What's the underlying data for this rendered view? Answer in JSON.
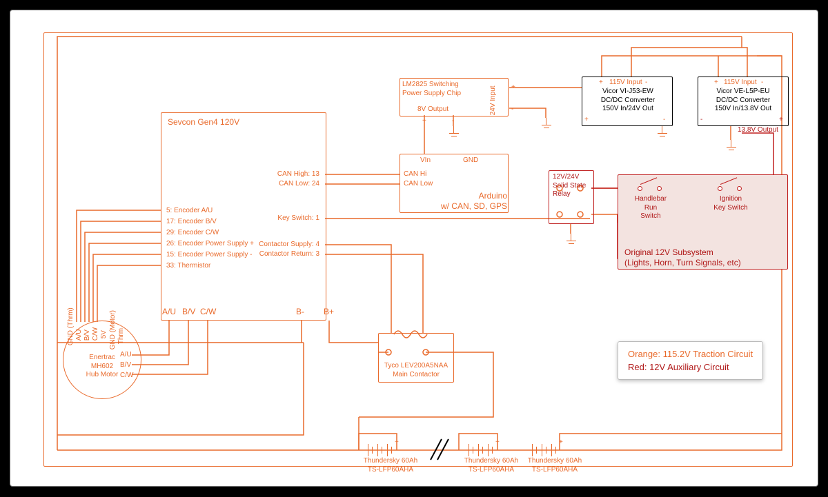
{
  "legend": {
    "traction": "Orange: 115.2V Traction Circuit",
    "aux": "Red: 12V Auxiliary Circuit"
  },
  "motor": {
    "name": "Enertrac\nMH602\nHub Motor",
    "terms": [
      "GND (Thrm)",
      "A/U",
      "B/V",
      "C/W",
      "5V",
      "GND (Motor)",
      "Thrm"
    ],
    "phases": [
      "A/U",
      "B/V",
      "C/W"
    ]
  },
  "sevcon": {
    "title": "Sevcon Gen4 120V",
    "left_pins": [
      "5: Encoder A/U",
      "17: Encoder B/V",
      "29: Encoder C/W",
      "26: Encoder Power Supply +",
      "15: Encoder Power Supply -",
      "33: Thermistor"
    ],
    "right_pins": [
      "CAN High: 13",
      "CAN Low: 24",
      "Key Switch: 1",
      "Contactor Supply: 4",
      "Contactor Return: 3"
    ],
    "hv_terms": [
      "A/U",
      "B/V",
      "C/W",
      "B-",
      "B+"
    ]
  },
  "arduino": {
    "title": "Arduino\nw/ CAN, SD, GPS",
    "pins": {
      "vin": "VIn",
      "gnd": "GND",
      "canh": "CAN Hi",
      "canl": "CAN Low"
    }
  },
  "lm2825": {
    "title": "LM2825 Switching\nPower Supply Chip",
    "out": "8V Output",
    "in": "24V Input"
  },
  "relay": {
    "title": "12V/24V\nSolid State\nRelay"
  },
  "subsys": {
    "title": "Original 12V Subsystem\n(Lights, Horn, Turn Signals, etc)",
    "switches": [
      "Handlebar\nRun\nSwitch",
      "Ignition\nKey Switch"
    ]
  },
  "dcdc24": {
    "title": "Vicor VI-J53-EW\nDC/DC Converter\n150V In/24V Out",
    "in": "115V Input",
    "polarity": [
      "+",
      "-",
      "-",
      "+"
    ]
  },
  "dcdc13": {
    "title": "Vicor VE-L5P-EU\nDC/DC Converter\n150V In/13.8V Out",
    "in": "115V Input",
    "out": "13.8V Output",
    "polarity": [
      "+",
      "-",
      "-",
      "+"
    ]
  },
  "contactor": {
    "title": "Tyco LEV200A5NAA\nMain Contactor"
  },
  "batteries": {
    "label": "Thundersky 60Ah\nTS-LFP60AHA",
    "count": 3,
    "plus": "+"
  }
}
